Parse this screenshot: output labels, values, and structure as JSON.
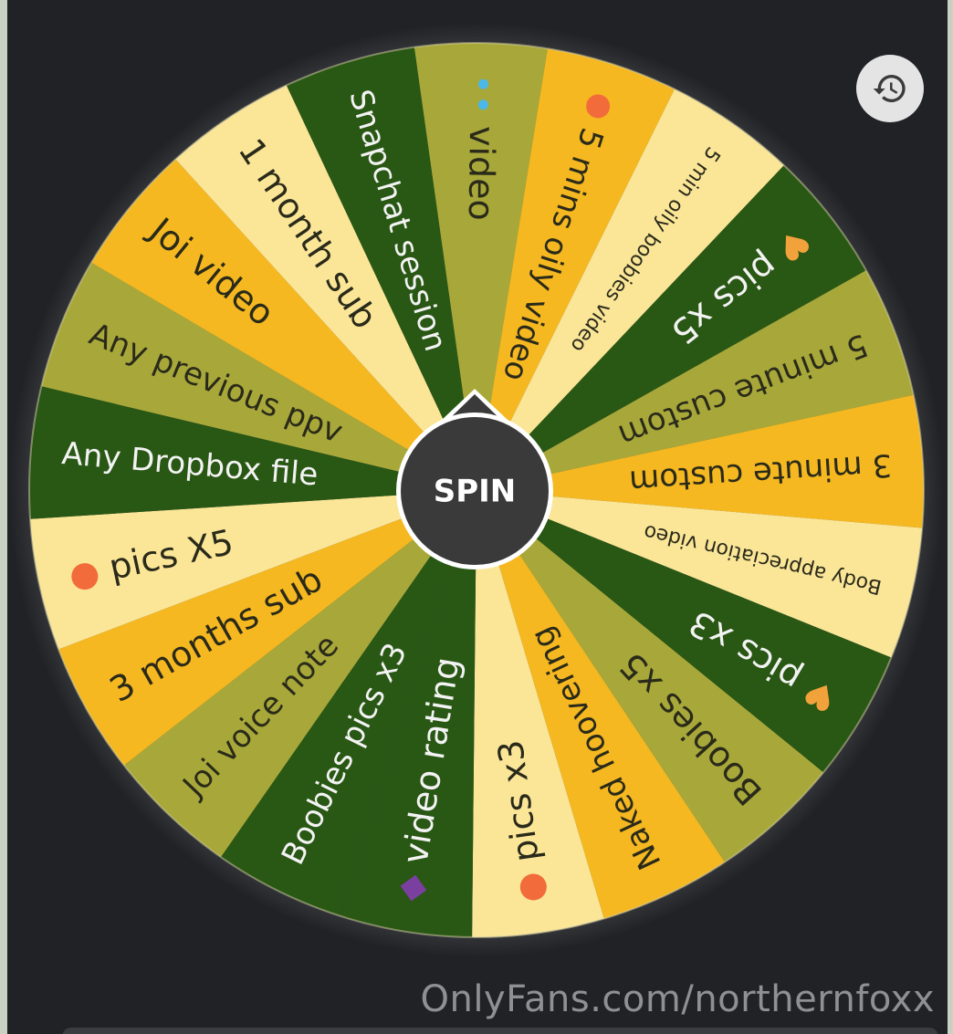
{
  "wheel": {
    "spin_label": "SPIN",
    "segments": [
      {
        "label": "video",
        "icon": "water-drops-icon",
        "color": "#a8a83a"
      },
      {
        "label": "5 mins oily",
        "icon": "peach-icon",
        "suffix": "video",
        "color": "#f5b820"
      },
      {
        "label": "5 min oily boobies video",
        "icon": "",
        "color": "#fbe698"
      },
      {
        "label": "pics x5",
        "icon": "heart-eyes-cat-icon",
        "color": "#295714"
      },
      {
        "label": "5 minute custom",
        "icon": "",
        "color": "#a8a83a"
      },
      {
        "label": "3 minute custom",
        "icon": "",
        "color": "#f5b820"
      },
      {
        "label": "Body appreciation video",
        "icon": "",
        "color": "#fbe698"
      },
      {
        "label": "pics x3",
        "icon": "heart-eyes-cat-icon",
        "color": "#295714"
      },
      {
        "label": "Boobies x5",
        "icon": "",
        "color": "#a8a83a"
      },
      {
        "label": "Naked hoovering",
        "icon": "",
        "color": "#f5b820"
      },
      {
        "label": "pics x3",
        "icon": "peach-icon",
        "color": "#fbe698"
      },
      {
        "label": "video",
        "icon": "eggplant-icon",
        "suffix": "rating",
        "color": "#295714"
      },
      {
        "label": "Boobies pics x3",
        "icon": "",
        "color": "#295714"
      },
      {
        "label": "Joi voice note",
        "icon": "",
        "color": "#a8a83a"
      },
      {
        "label": "3 months sub",
        "icon": "",
        "color": "#f5b820"
      },
      {
        "label": "pics X5",
        "icon": "peach-icon",
        "color": "#fbe698"
      },
      {
        "label": "Any Dropbox file",
        "icon": "",
        "color": "#295714"
      },
      {
        "label": "Any previous ppv",
        "icon": "",
        "color": "#a8a83a"
      },
      {
        "label": "Joi video",
        "icon": "",
        "color": "#f5b820"
      },
      {
        "label": "1 month sub",
        "icon": "",
        "color": "#fbe698"
      },
      {
        "label": "Snapchat session",
        "icon": "",
        "color": "#295714"
      }
    ]
  },
  "history_button": {
    "icon": "history-icon"
  },
  "watermark": "OnlyFans.com/northernfoxx"
}
